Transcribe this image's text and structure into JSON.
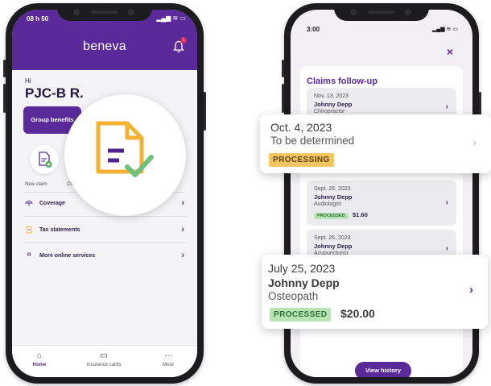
{
  "left_phone": {
    "status_time": "08 h 50",
    "status_icons": "▂▄▆ ≋ ▭",
    "brand": "beneva",
    "bell_badge": "1",
    "greeting_small": "Hi",
    "user_name": "PJC-B R.",
    "group_benefits_label": "Group benefits",
    "quick_actions": [
      {
        "label": "New claim",
        "icon": "document-plus-icon"
      },
      {
        "label": "Cla",
        "icon": "claims-icon"
      }
    ],
    "menu": [
      {
        "label": "Coverage",
        "icon": "umbrella-icon"
      },
      {
        "label": "Tax statements",
        "icon": "document-icon"
      },
      {
        "label": "More online services",
        "icon": "person-icon"
      }
    ],
    "nav": [
      {
        "label": "Home",
        "icon": "home-icon",
        "active": true
      },
      {
        "label": "Insurance cards",
        "icon": "card-icon",
        "active": false
      },
      {
        "label": "More",
        "icon": "more-icon",
        "active": false
      }
    ],
    "overlay_icon": "document-check-icon"
  },
  "right_phone": {
    "status_time": "3:00",
    "status_icons": "▂▄▆ ≋ ▭",
    "close_label": "×",
    "title": "Claims follow-up",
    "claims": [
      {
        "date": "Nov. 13, 2023",
        "name": "Johnny Depp",
        "specialty": "Chiropractor"
      },
      {
        "date": "Sept. 26, 2023",
        "name": "Johnny Depp",
        "specialty": "Audiologist",
        "status": "PROCESSED",
        "amount": "$1.60"
      },
      {
        "date": "Sept. 26, 2023",
        "name": "Johnny Depp",
        "specialty": "Acupuncturist"
      }
    ],
    "view_history_label": "View history"
  },
  "popouts": {
    "top": {
      "date": "Oct. 4, 2023",
      "description": "To be determined",
      "status": "PROCESSING"
    },
    "bottom": {
      "date": "July 25, 2023",
      "name": "Johnny Depp",
      "specialty": "Osteopath",
      "status": "PROCESSED",
      "amount": "$20.00"
    }
  },
  "colors": {
    "brand_purple": "#5b2a9a",
    "processing_yellow": "#f4c561",
    "processed_green": "#b9e5b5",
    "doc_icon_yellow": "#f2b233",
    "check_green": "#6ec07a"
  }
}
